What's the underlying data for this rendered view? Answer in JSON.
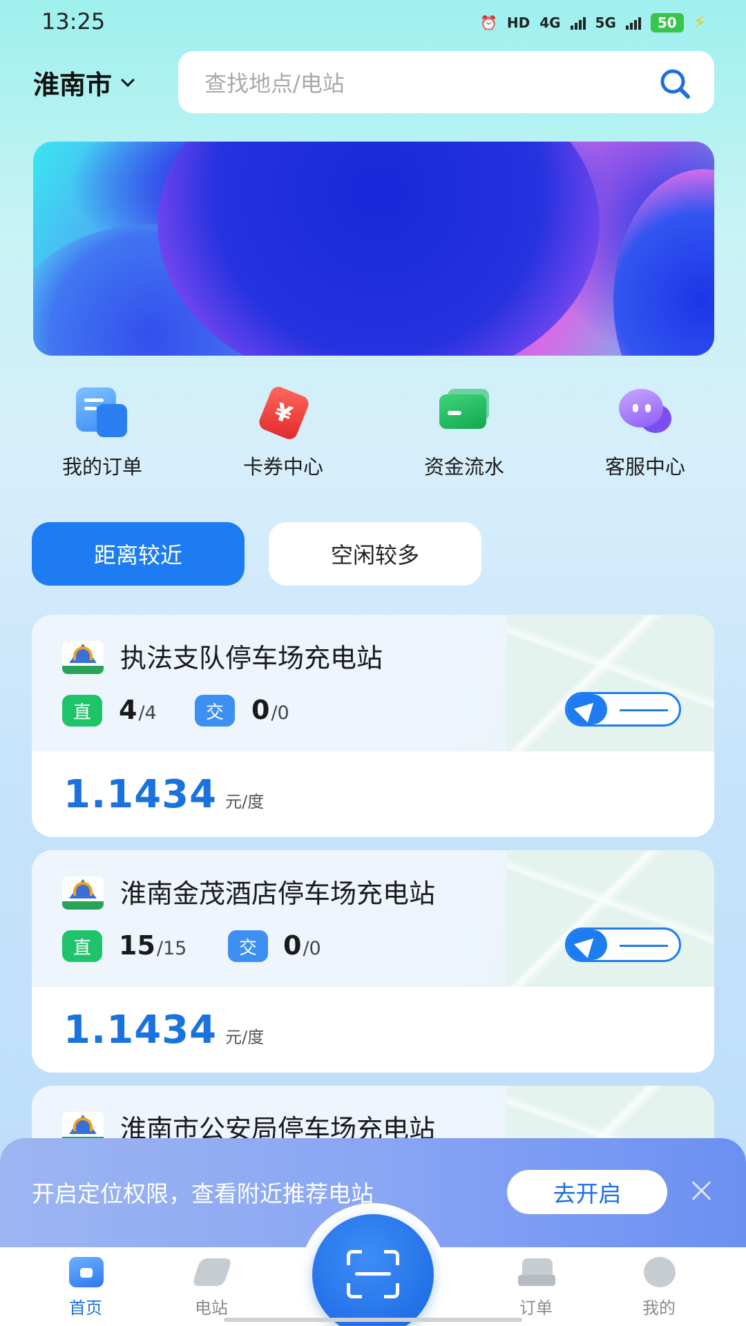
{
  "status_bar": {
    "time": "13:25",
    "hd": "HD",
    "net4g": "4G",
    "net5g": "5G",
    "battery": "50"
  },
  "header": {
    "city": "淮南市",
    "search_placeholder": "查找地点/电站"
  },
  "quick_menu": [
    {
      "label": "我的订单",
      "icon": "order-icon"
    },
    {
      "label": "卡券中心",
      "icon": "coupon-icon"
    },
    {
      "label": "资金流水",
      "icon": "wallet-icon"
    },
    {
      "label": "客服中心",
      "icon": "chat-icon"
    }
  ],
  "filters": {
    "nearest": "距离较近",
    "most_idle": "空闲较多"
  },
  "stations": [
    {
      "name": "执法支队停车场充电站",
      "dc_label": "直",
      "dc_free": "4",
      "dc_total": "/4",
      "ac_label": "交",
      "ac_free": "0",
      "ac_total": "/0",
      "price": "1.1434",
      "unit": "元/度"
    },
    {
      "name": "淮南金茂酒店停车场充电站",
      "dc_label": "直",
      "dc_free": "15",
      "dc_total": "/15",
      "ac_label": "交",
      "ac_free": "0",
      "ac_total": "/0",
      "price": "1.1434",
      "unit": "元/度"
    },
    {
      "name": "淮南市公安局停车场充电站"
    }
  ],
  "location_prompt": {
    "text": "开启定位权限，查看附近推荐电站",
    "button": "去开启"
  },
  "bottom_nav": {
    "home": "首页",
    "station": "电站",
    "order": "订单",
    "mine": "我的"
  },
  "colors": {
    "accent": "#1d7cf2",
    "price": "#1a72e0",
    "dc_green": "#1fc46a"
  }
}
